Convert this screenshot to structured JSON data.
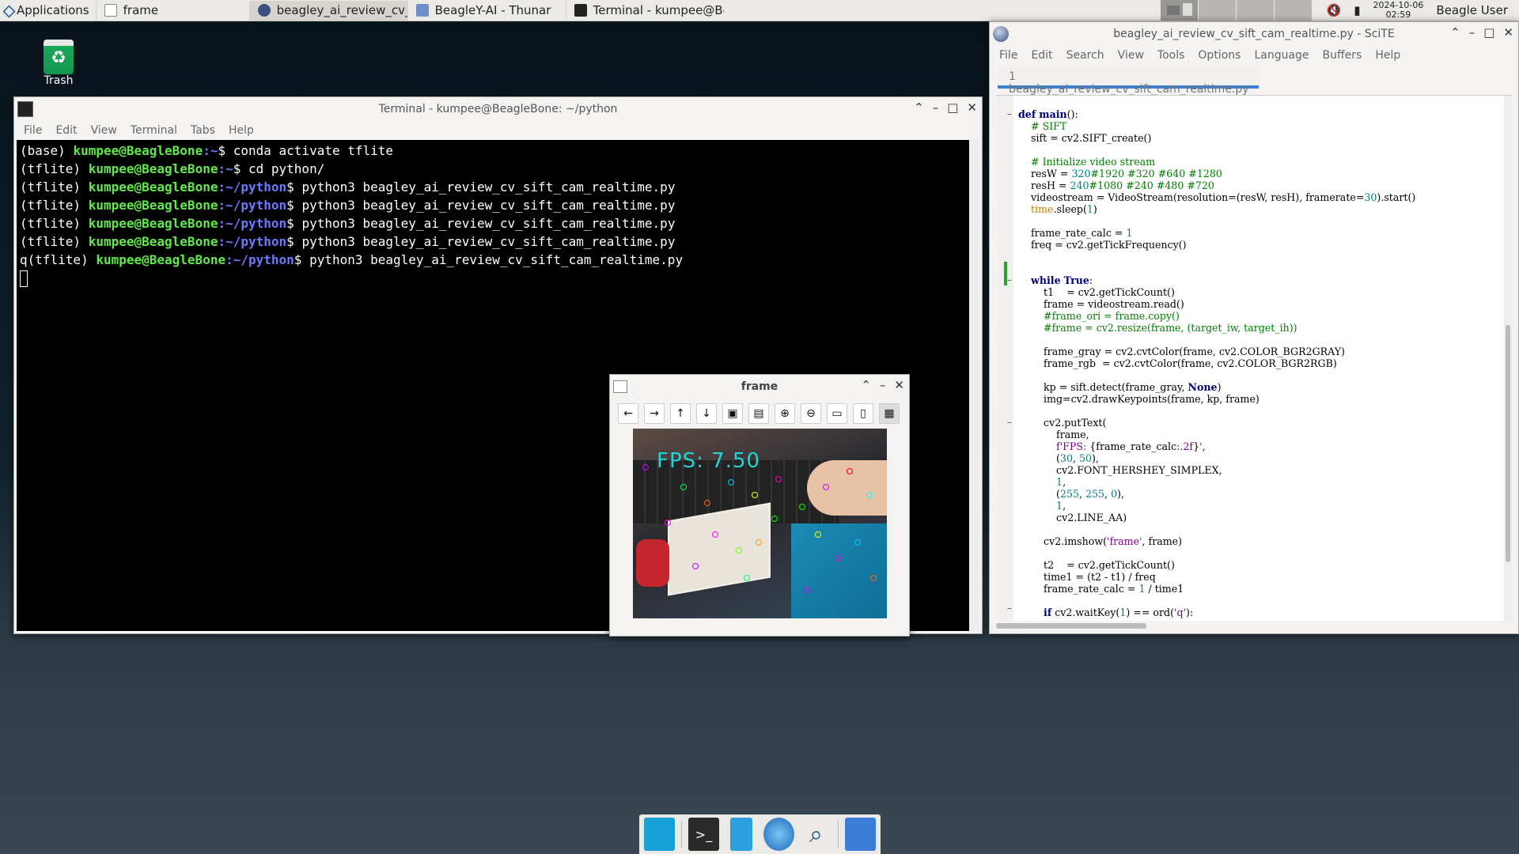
{
  "panel": {
    "applications_label": "Applications",
    "tasks": [
      {
        "label": "frame"
      },
      {
        "label": "beagley_ai_review_cv_..."
      },
      {
        "label": "BeagleY-AI - Thunar"
      },
      {
        "label": "Terminal - kumpee@Be..."
      }
    ],
    "clock_date": "2024-10-06",
    "clock_time": "02:59",
    "user": "Beagle User"
  },
  "desktop": {
    "trash_label": "Trash"
  },
  "terminal": {
    "title": "Terminal - kumpee@BeagleBone: ~/python",
    "menu": [
      "File",
      "Edit",
      "View",
      "Terminal",
      "Tabs",
      "Help"
    ],
    "lines": [
      {
        "env": "(base) ",
        "host": "kumpee@BeagleBone",
        "path": ":~",
        "cmd": "$ conda activate tflite"
      },
      {
        "env": "(tflite) ",
        "host": "kumpee@BeagleBone",
        "path": ":~",
        "cmd": "$ cd python/"
      },
      {
        "env": "(tflite) ",
        "host": "kumpee@BeagleBone",
        "path": ":~/python",
        "cmd": "$ python3 beagley_ai_review_cv_sift_cam_realtime.py"
      },
      {
        "env": "(tflite) ",
        "host": "kumpee@BeagleBone",
        "path": ":~/python",
        "cmd": "$ python3 beagley_ai_review_cv_sift_cam_realtime.py"
      },
      {
        "env": "(tflite) ",
        "host": "kumpee@BeagleBone",
        "path": ":~/python",
        "cmd": "$ python3 beagley_ai_review_cv_sift_cam_realtime.py"
      },
      {
        "env": "(tflite) ",
        "host": "kumpee@BeagleBone",
        "path": ":~/python",
        "cmd": "$ python3 beagley_ai_review_cv_sift_cam_realtime.py"
      },
      {
        "env": "q(tflite) ",
        "host": "kumpee@BeagleBone",
        "path": ":~/python",
        "cmd": "$ python3 beagley_ai_review_cv_sift_cam_realtime.py"
      }
    ]
  },
  "scite": {
    "title": "beagley_ai_review_cv_sift_cam_realtime.py - SciTE",
    "menu": [
      "File",
      "Edit",
      "Search",
      "View",
      "Tools",
      "Options",
      "Language",
      "Buffers",
      "Help"
    ],
    "tab": "1 beagley_ai_review_cv_sift_cam_realtime.py"
  },
  "frame_window": {
    "title": "frame",
    "fps_text": "FPS: 7.50",
    "toolbar_icons": [
      "arrow-left-icon",
      "arrow-right-icon",
      "arrow-up-icon",
      "arrow-down-icon",
      "image-icon",
      "image-settings-icon",
      "zoom-in-icon",
      "zoom-out-icon",
      "save-icon",
      "clipboard-icon",
      "properties-icon"
    ]
  },
  "dock": {
    "items": [
      "show-desktop-icon",
      "terminal-icon",
      "file-manager-icon",
      "web-browser-icon",
      "app-finder-icon",
      "folder-icon"
    ]
  }
}
